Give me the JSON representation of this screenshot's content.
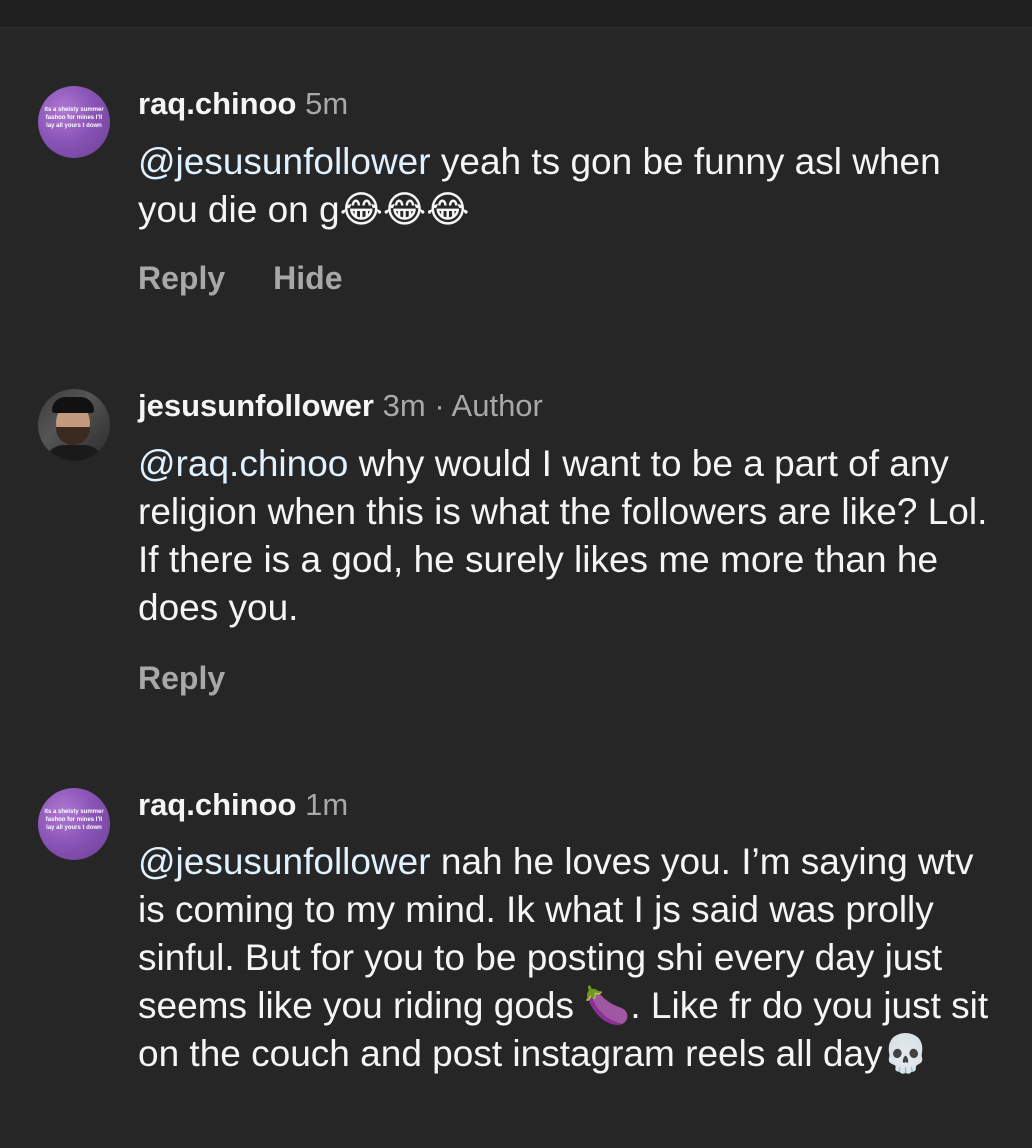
{
  "comments": [
    {
      "avatar_text": "its a sheisty summer fashoo for mines I'll lay all yours t down",
      "username": "raq.chinoo",
      "time": "5m",
      "mention": "@jesusunfollower",
      "text": " yeah ts gon be funny asl when you die on g",
      "emoji": "😂😂😂",
      "reply_label": "Reply",
      "hide_label": "Hide"
    },
    {
      "username": "jesusunfollower",
      "time": "3m",
      "author_tag": "· Author",
      "mention": "@raq.chinoo",
      "text": " why would I want to be a part of any religion when this is what the followers are like? Lol. If there is a god, he surely likes me more than he does you.",
      "reply_label": "Reply"
    },
    {
      "avatar_text": "its a sheisty summer fashoo for mines I'll lay all yours t down",
      "username": "raq.chinoo",
      "time": "1m",
      "mention": "@jesusunfollower",
      "text_part1": " nah he loves you. I’m saying wtv is coming to my mind. Ik what I js said was prolly sinful. But for you to be posting shi every day just seems like you riding gods ",
      "emoji1": "🍆",
      "text_part2": ". Like fr do you just sit on the couch and post instagram reels all day",
      "emoji2": "💀"
    }
  ]
}
